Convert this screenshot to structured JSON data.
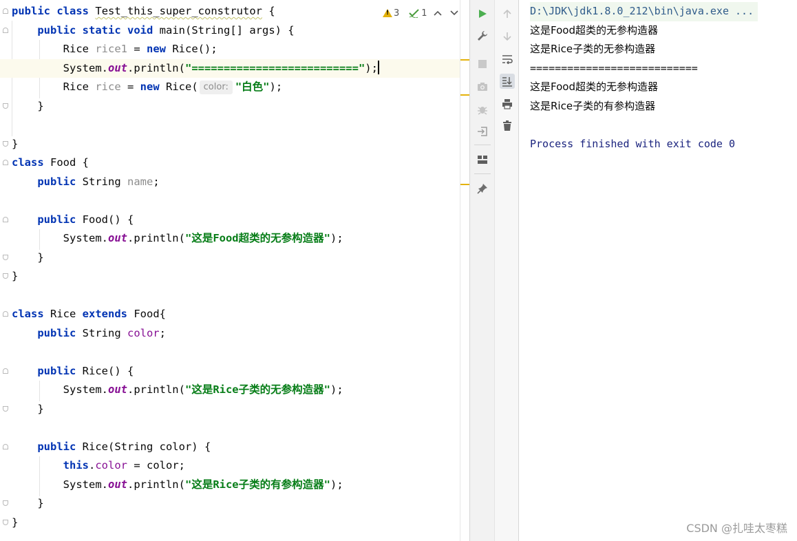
{
  "editor": {
    "inspection": {
      "warnings": "3",
      "weak_warnings": "1"
    },
    "code": {
      "l1": {
        "kw1": "public",
        "kw2": "class",
        "name": "Test_this_super_construtor",
        "rest": " {"
      },
      "l2": {
        "kw1": "public",
        "kw2": "static",
        "kw3": "void",
        "rest": " main(String[] args) {"
      },
      "l3": {
        "type": "Rice ",
        "var": "rice1",
        "eq": " = ",
        "kw": "new",
        "rest": " Rice();"
      },
      "l4": {
        "pre": "System.",
        "out": "out",
        "mid": ".println(",
        "str": "\"==========================\"",
        "end": ");"
      },
      "l5": {
        "type": "Rice ",
        "var": "rice",
        "eq": " = ",
        "kw": "new",
        "mid": " Rice(",
        "hint": "color:",
        "str": "\"白色\"",
        "end": ");"
      },
      "l6": "}",
      "l8": "}",
      "l9": {
        "kw": "class",
        "rest": " Food {"
      },
      "l10": {
        "kw": "public",
        "type": " String ",
        "field": "name",
        "end": ";"
      },
      "l12": {
        "kw": "public",
        "rest": " Food() {"
      },
      "l13": {
        "pre": "System.",
        "out": "out",
        "mid": ".println(",
        "str": "\"这是Food超类的无参构造器\"",
        "end": ");"
      },
      "l14": "}",
      "l15": "}",
      "l17": {
        "kw1": "class",
        "mid": " Rice ",
        "kw2": "extends",
        "rest": " Food{"
      },
      "l18": {
        "kw": "public",
        "type": " String ",
        "field": "color",
        "end": ";"
      },
      "l20": {
        "kw": "public",
        "rest": " Rice() {"
      },
      "l21": {
        "pre": "System.",
        "out": "out",
        "mid": ".println(",
        "str": "\"这是Rice子类的无参构造器\"",
        "end": ");"
      },
      "l22": "}",
      "l24": {
        "kw": "public",
        "rest": " Rice(String color) {"
      },
      "l25": {
        "kw": "this",
        "dot": ".",
        "field": "color",
        "rest": " = color;"
      },
      "l26": {
        "pre": "System.",
        "out": "out",
        "mid": ".println(",
        "str": "\"这是Rice子类的有参构造器\"",
        "end": ");"
      },
      "l27": "}",
      "l28": "}"
    }
  },
  "run_toolbar": {
    "icons": [
      "run-icon",
      "wrench-icon",
      "stop-icon",
      "camera-icon",
      "debug-icon",
      "login-icon",
      "layout-icon",
      "pin-icon"
    ],
    "icons2": [
      "arrow-up-icon",
      "arrow-down-icon",
      "soft-wrap-icon",
      "scroll-to-end-icon",
      "print-icon",
      "trash-icon"
    ]
  },
  "console": {
    "lines": [
      "D:\\JDK\\jdk1.8.0_212\\bin\\java.exe ...",
      "这是Food超类的无参构造器",
      "这是Rice子类的无参构造器",
      "===========================",
      "这是Food超类的无参构造器",
      "这是Rice子类的有参构造器",
      "",
      "Process finished with exit code 0"
    ]
  },
  "watermark": "CSDN @扎哇太枣糕",
  "colors": {
    "keyword": "#0033b3",
    "string": "#067d17",
    "field": "#871094",
    "current_line": "#fcfaed",
    "warning": "#e4b20b"
  }
}
